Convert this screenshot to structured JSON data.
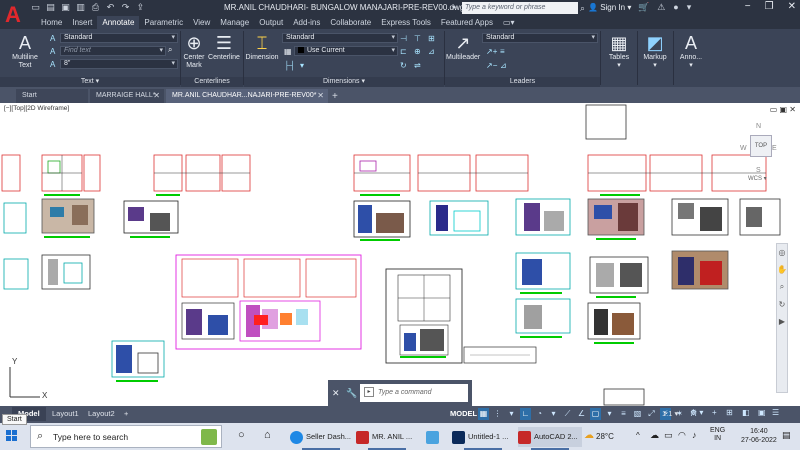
{
  "app": {
    "logo": "A",
    "document_title": "MR.ANIL CHAUDHARI- BUNGALOW MANAJARI-PRE-REV00.dwg",
    "search_placeholder": "Type a keyword or phrase",
    "sign_in": "Sign In",
    "help": "?"
  },
  "ribbon_tabs": [
    "Home",
    "Insert",
    "Annotate",
    "Parametric",
    "View",
    "Manage",
    "Output",
    "Add-ins",
    "Collaborate",
    "Express Tools",
    "Featured Apps"
  ],
  "ribbon": {
    "text_panel": {
      "title": "Text",
      "multiline_text": "Multiline\nText",
      "text_style": "Standard",
      "find_text": "Find text",
      "text_height": "8\""
    },
    "centerlines_panel": {
      "title": "Centerlines",
      "center_mark": "Center\nMark",
      "centerline": "Centerline"
    },
    "dimensions_panel": {
      "title": "Dimensions",
      "dimension": "Dimension",
      "dim_style": "Standard",
      "layer": "Use Current"
    },
    "leaders_panel": {
      "title": "Leaders",
      "multileader": "Multileader",
      "mleader_style": "Standard"
    },
    "tables": "Tables",
    "markup": "Markup",
    "annotation": "Anno..."
  },
  "file_tabs": [
    {
      "label": "Start",
      "closable": false,
      "active": false
    },
    {
      "label": "MARRAIGE HALL*",
      "closable": true,
      "active": false
    },
    {
      "label": "MR.ANIL CHAUDHAR...NAJARI-PRE-REV00*",
      "closable": true,
      "active": true
    }
  ],
  "viewport": {
    "label": "[−][Top][2D Wireframe]",
    "viewcube_face": "TOP",
    "compass": {
      "n": "N",
      "e": "E",
      "s": "S",
      "w": "W"
    },
    "wcs": "WCS",
    "axis_y": "Y",
    "axis_x": "X"
  },
  "command_line": {
    "placeholder": "Type a command"
  },
  "layout_tabs": [
    "Model",
    "Layout1",
    "Layout2"
  ],
  "layout_add": "+",
  "status": {
    "model": "MODEL",
    "scale": "1:1",
    "start_tooltip": "Start"
  },
  "taskbar": {
    "search_placeholder": "Type here to search",
    "apps": [
      {
        "label": "Seller Dash...",
        "color": "#1e88e5"
      },
      {
        "label": "MR. ANIL ...",
        "color": "#c62828"
      },
      {
        "label": "",
        "color": "#4aa3df"
      },
      {
        "label": "Untitled-1 ...",
        "color": "#0b2a5a"
      },
      {
        "label": "AutoCAD 2...",
        "color": "#c62828"
      }
    ],
    "weather": "28°C",
    "language": "ENG\nIN",
    "time": "16:40",
    "date": "27-06-2022"
  },
  "colors": {
    "accent": "#2e6fa8",
    "autocad_red": "#e0282c",
    "ribbon_bg": "#3b4457",
    "title_bg": "#2c3341"
  }
}
